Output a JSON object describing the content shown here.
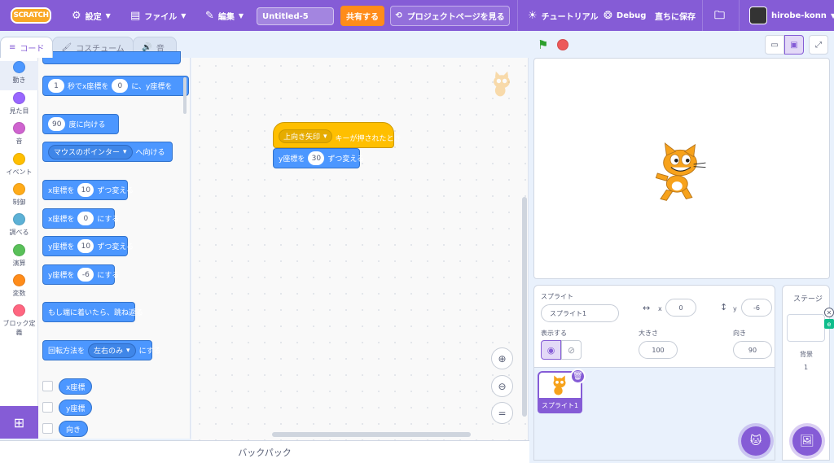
{
  "menu": {
    "logo": "SCRATCH",
    "settings": "設定",
    "file": "ファイル",
    "edit": "編集",
    "project_title": "Untitled-5",
    "share": "共有する",
    "project_page": "プロジェクトページを見る",
    "tutorials": "チュートリアル",
    "debug": "Debug",
    "save_now": "直ちに保存",
    "username": "hirobe-konn"
  },
  "tabs": [
    {
      "label": "コード",
      "icon": "code-icon"
    },
    {
      "label": "コスチューム",
      "icon": "brush-icon"
    },
    {
      "label": "音",
      "icon": "speaker-icon"
    }
  ],
  "categories": [
    {
      "label": "動き",
      "color": "#4c97ff"
    },
    {
      "label": "見た目",
      "color": "#9966ff"
    },
    {
      "label": "音",
      "color": "#cf63cf"
    },
    {
      "label": "イベント",
      "color": "#ffbf00"
    },
    {
      "label": "制御",
      "color": "#ffab19"
    },
    {
      "label": "調べる",
      "color": "#5cb1d6"
    },
    {
      "label": "演算",
      "color": "#59c059"
    },
    {
      "label": "変数",
      "color": "#ff8c1a"
    },
    {
      "label": "ブロック定義",
      "color": "#ff6680"
    }
  ],
  "palette": {
    "glide_to_xy": {
      "pre": "秒でx座標を",
      "secs": "1",
      "x": "0",
      "mid": "に、y座標を"
    },
    "point_dir": {
      "value": "90",
      "text": "度に向ける"
    },
    "point_towards": {
      "option": "マウスのポインター",
      "text": "へ向ける"
    },
    "change_x": {
      "pre": "x座標を",
      "value": "10",
      "post": "ずつ変える"
    },
    "set_x": {
      "pre": "x座標を",
      "value": "0",
      "post": "にする"
    },
    "change_y": {
      "pre": "y座標を",
      "value": "10",
      "post": "ずつ変える"
    },
    "set_y": {
      "pre": "y座標を",
      "value": "-6",
      "post": "にする"
    },
    "bounce": "もし端に着いたら、跳ね返る",
    "rotation": {
      "pre": "回転方法を",
      "option": "左右のみ",
      "post": "にする"
    },
    "reporters": [
      "x座標",
      "y座標",
      "向き"
    ]
  },
  "script": {
    "hat_key": "上向き矢印",
    "hat_text": "キーが押されたとき",
    "change_y_pre": "y座標を",
    "change_y_value": "30",
    "change_y_post": "ずつ変える"
  },
  "backpack": "バックパック",
  "zoom_reset": "=",
  "sprite_info": {
    "label": "スプライト",
    "name": "スプライト1",
    "x_label": "x",
    "x": "0",
    "y_label": "y",
    "y": "-6",
    "show_label": "表示する",
    "size_label": "大きさ",
    "size": "100",
    "direction_label": "向き",
    "direction": "90"
  },
  "sprites": [
    {
      "name": "スプライト1"
    }
  ],
  "stage_panel": {
    "title": "ステージ",
    "backdrops_label": "背景",
    "backdrops_count": "1"
  }
}
